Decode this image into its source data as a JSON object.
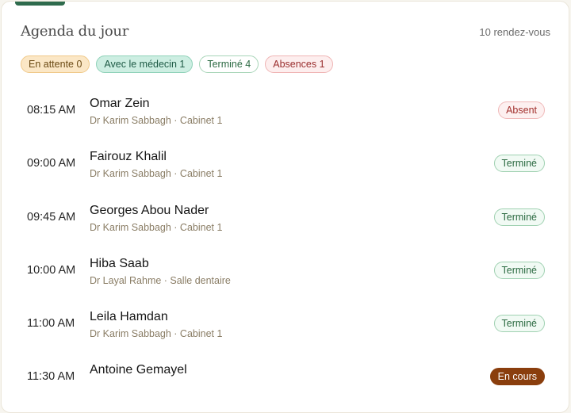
{
  "header": {
    "title": "Agenda du jour",
    "count_label": "10 rendez-vous"
  },
  "filters": [
    {
      "label": "En attente 0"
    },
    {
      "label": "Avec le médecin 1"
    },
    {
      "label": "Terminé 4"
    },
    {
      "label": "Absences 1"
    }
  ],
  "appointments": [
    {
      "time": "08:15 AM",
      "name": "Omar Zein",
      "meta": "Dr Karim Sabbagh · Cabinet 1",
      "status": "Absent"
    },
    {
      "time": "09:00 AM",
      "name": "Fairouz Khalil",
      "meta": "Dr Karim Sabbagh · Cabinet 1",
      "status": "Terminé"
    },
    {
      "time": "09:45 AM",
      "name": "Georges Abou Nader",
      "meta": "Dr Karim Sabbagh · Cabinet 1",
      "status": "Terminé"
    },
    {
      "time": "10:00 AM",
      "name": "Hiba Saab",
      "meta": "Dr Layal Rahme · Salle dentaire",
      "status": "Terminé"
    },
    {
      "time": "11:00 AM",
      "name": "Leila Hamdan",
      "meta": "Dr Karim Sabbagh · Cabinet 1",
      "status": "Terminé"
    },
    {
      "time": "11:30 AM",
      "name": "Antoine Gemayel",
      "meta": "",
      "status": "En cours"
    }
  ],
  "colors": {
    "accent": "#2e6b4d",
    "in_progress": "#8a3e0d"
  }
}
